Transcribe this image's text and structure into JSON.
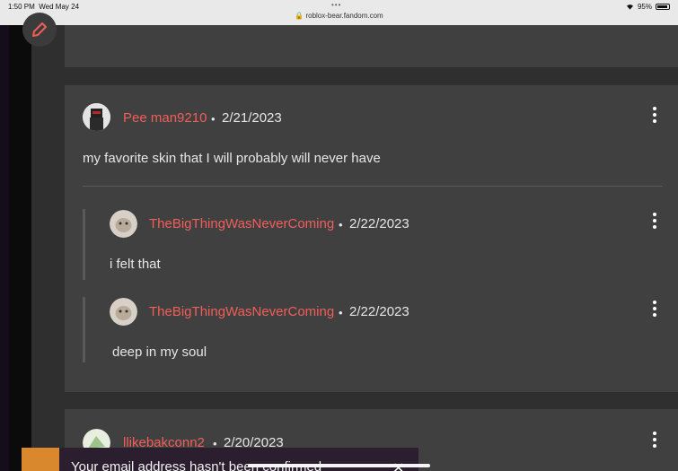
{
  "status_bar": {
    "time": "1:50 PM",
    "date": "Wed May 24",
    "dots": "•••",
    "url": "roblox-bear.fandom.com",
    "battery": "95%"
  },
  "comment": {
    "author": "Pee man9210",
    "separator": "•",
    "date": "2/21/2023",
    "text": "my favorite skin that I will probably will never have"
  },
  "replies": [
    {
      "author": "TheBigThingWasNeverComing",
      "separator": "•",
      "date": "2/22/2023",
      "text": "i felt that"
    },
    {
      "author": "TheBigThingWasNeverComing",
      "separator": "•",
      "date": "2/22/2023",
      "text": "deep in my soul"
    }
  ],
  "next_comment": {
    "author": "llikebakconn2",
    "separator": "•",
    "date": "2/20/2023"
  },
  "banner": {
    "text": "Your email address hasn't been confirmed",
    "close": "✕"
  },
  "colors": {
    "author_link": "#ef5f5a",
    "card": "#404040",
    "accent": "#d9882e"
  }
}
